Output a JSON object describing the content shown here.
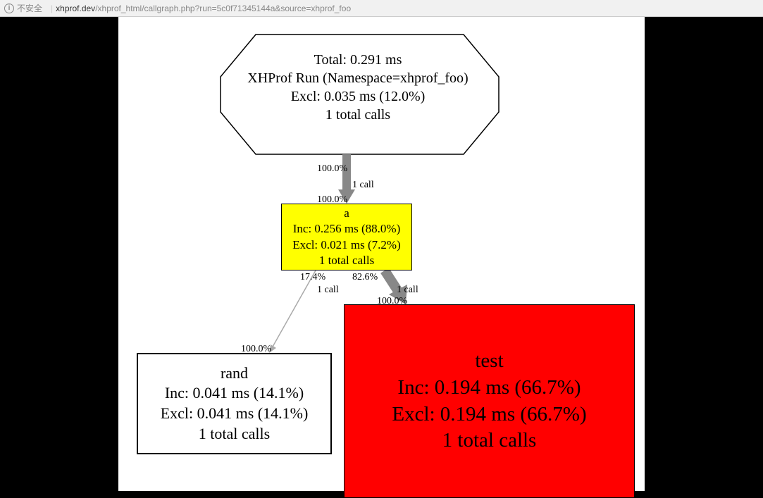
{
  "browser": {
    "security_text": "不安全",
    "url_domain": "xhprof.dev",
    "url_path": "/xhprof_html/callgraph.php?run=5c0f71345144a&source=xhprof_foo"
  },
  "root": {
    "line1": "Total: 0.291 ms",
    "line2": "XHProf Run (Namespace=xhprof_foo)",
    "line3": "Excl: 0.035 ms (12.0%)",
    "line4": "1 total calls"
  },
  "node_a": {
    "name": "a",
    "inc": "Inc: 0.256 ms (88.0%)",
    "excl": "Excl: 0.021 ms (7.2%)",
    "calls": "1 total calls"
  },
  "node_rand": {
    "name": "rand",
    "inc": "Inc: 0.041 ms (14.1%)",
    "excl": "Excl: 0.041 ms (14.1%)",
    "calls": "1 total calls"
  },
  "node_test": {
    "name": "test",
    "inc": "Inc: 0.194 ms (66.7%)",
    "excl": "Excl: 0.194 ms (66.7%)",
    "calls": "1 total calls"
  },
  "edges": {
    "root_a_out": "100.0%",
    "root_a_call": "1 call",
    "root_a_in": "100.0%",
    "a_rand_out": "17.4%",
    "a_rand_call": "1 call",
    "a_rand_in": "100.0%",
    "a_test_out": "82.6%",
    "a_test_call": "1 call",
    "a_test_in": "100.0%"
  }
}
